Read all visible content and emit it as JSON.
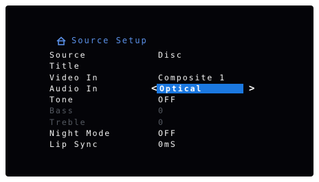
{
  "menu": {
    "title": "Source Setup",
    "icon": "home-icon",
    "accent_color": "#5a8fe6",
    "highlight_color": "#1b78e0",
    "items": [
      {
        "label": "Source",
        "value": "Disc"
      },
      {
        "label": "Title",
        "value": ""
      },
      {
        "label": "Video In",
        "value": "Composite 1"
      },
      {
        "label": "Audio In",
        "value": "Optical",
        "selected": true
      },
      {
        "label": "Tone",
        "value": "OFF"
      },
      {
        "label": "Bass",
        "value": "0",
        "disabled": true
      },
      {
        "label": "Treble",
        "value": "0",
        "disabled": true
      },
      {
        "label": "Night Mode",
        "value": "OFF"
      },
      {
        "label": "Lip Sync",
        "value": "0mS"
      }
    ],
    "arrow_left": "<",
    "arrow_right": ">"
  }
}
